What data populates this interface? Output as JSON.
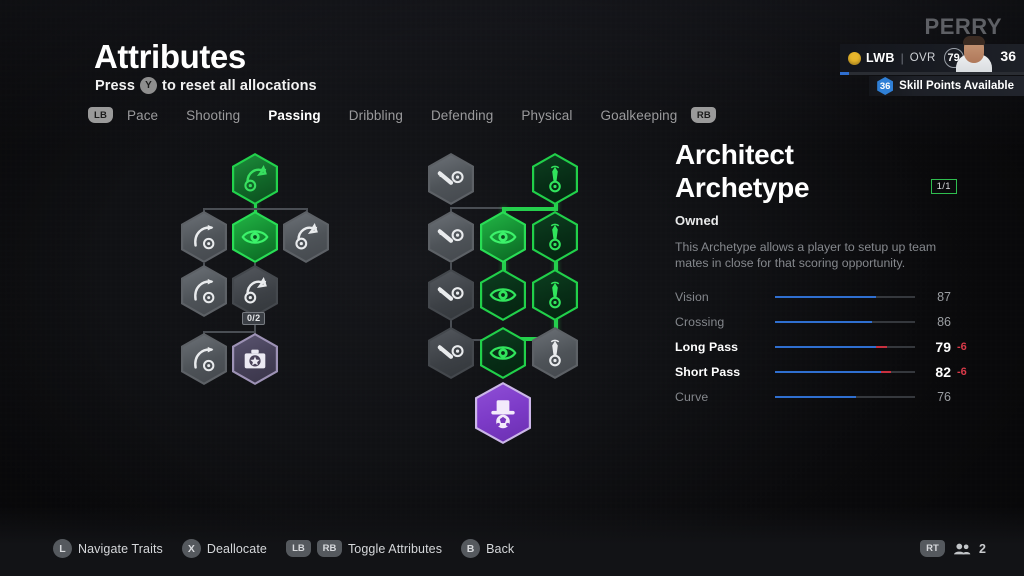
{
  "header": {
    "title": "Attributes",
    "subtitle_pre": "Press",
    "subtitle_button": "Y",
    "subtitle_post": "to reset all allocations"
  },
  "tabs": {
    "left_bumper": "LB",
    "right_bumper": "RB",
    "items": [
      {
        "label": "Pace",
        "active": false
      },
      {
        "label": "Shooting",
        "active": false
      },
      {
        "label": "Passing",
        "active": true
      },
      {
        "label": "Dribbling",
        "active": false
      },
      {
        "label": "Defending",
        "active": false
      },
      {
        "label": "Physical",
        "active": false
      },
      {
        "label": "Goalkeeping",
        "active": false
      }
    ]
  },
  "player_card": {
    "name": "PERRY",
    "position": "LWB",
    "ovr_label": "OVR",
    "ovr_value": "79",
    "level": "36",
    "skill_points_value": "36",
    "skill_points_label": "Skill Points Available",
    "separator": "|"
  },
  "archetype": {
    "title_line1": "Architect",
    "title_line2": "Archetype",
    "rank_chip": "1/1",
    "status": "Owned",
    "description": "This Archetype allows a player to setup up team mates in close for that scoring opportunity.",
    "attributes": [
      {
        "name": "Vision",
        "value": "87",
        "delta": "",
        "pct": 72,
        "highlight": false
      },
      {
        "name": "Crossing",
        "value": "86",
        "delta": "",
        "pct": 69,
        "highlight": false
      },
      {
        "name": "Long Pass",
        "value": "79",
        "delta": "-6",
        "pct": 79,
        "highlight": true
      },
      {
        "name": "Short Pass",
        "value": "82",
        "delta": "-6",
        "pct": 82,
        "highlight": true
      },
      {
        "name": "Curve",
        "value": "76",
        "delta": "",
        "pct": 58,
        "highlight": false
      }
    ]
  },
  "tree_left": {
    "badge_value": "0/2",
    "nodes": [
      {
        "id": "l-root",
        "icon": "long-pass-icon",
        "state": "greenfill"
      },
      {
        "id": "l-ml",
        "icon": "curve-icon",
        "state": "grey"
      },
      {
        "id": "l-mc",
        "icon": "vision-eye-icon",
        "state": "greenbright"
      },
      {
        "id": "l-mr",
        "icon": "long-pass-icon",
        "state": "grey"
      },
      {
        "id": "l-bl",
        "icon": "curve-icon",
        "state": "grey"
      },
      {
        "id": "l-bc",
        "icon": "long-pass-icon",
        "state": "dark"
      },
      {
        "id": "l-fl",
        "icon": "curve-icon",
        "state": "grey"
      },
      {
        "id": "l-fc",
        "icon": "trait-badge-icon",
        "state": "lav"
      }
    ]
  },
  "tree_right": {
    "nodes": [
      {
        "id": "r-l1",
        "icon": "short-pass-icon",
        "state": "grey"
      },
      {
        "id": "r-r1",
        "icon": "crossing-icon",
        "state": "green"
      },
      {
        "id": "r-l2",
        "icon": "short-pass-icon",
        "state": "grey"
      },
      {
        "id": "r-c2",
        "icon": "vision-eye-icon",
        "state": "greenbright"
      },
      {
        "id": "r-r2",
        "icon": "crossing-icon",
        "state": "green"
      },
      {
        "id": "r-l3",
        "icon": "short-pass-icon",
        "state": "dark"
      },
      {
        "id": "r-c3",
        "icon": "vision-eye-icon",
        "state": "green"
      },
      {
        "id": "r-r3",
        "icon": "crossing-icon",
        "state": "green"
      },
      {
        "id": "r-l4",
        "icon": "short-pass-icon",
        "state": "dark"
      },
      {
        "id": "r-c4",
        "icon": "vision-eye-icon",
        "state": "green"
      },
      {
        "id": "r-r4",
        "icon": "crossing-icon",
        "state": "grey"
      },
      {
        "id": "r-c5",
        "icon": "playmaker-hat-icon",
        "state": "purple"
      }
    ]
  },
  "footer": {
    "actions": [
      {
        "button": "L",
        "label": "Navigate Traits",
        "type": "circle"
      },
      {
        "button": "X",
        "label": "Deallocate",
        "type": "circle"
      },
      {
        "button": "LB",
        "label": "",
        "type": "bumper"
      },
      {
        "button": "RB",
        "label": "Toggle Attributes",
        "type": "bumper"
      },
      {
        "button": "B",
        "label": "Back",
        "type": "circle"
      }
    ],
    "right_trigger": "RT",
    "player_count": "2"
  }
}
